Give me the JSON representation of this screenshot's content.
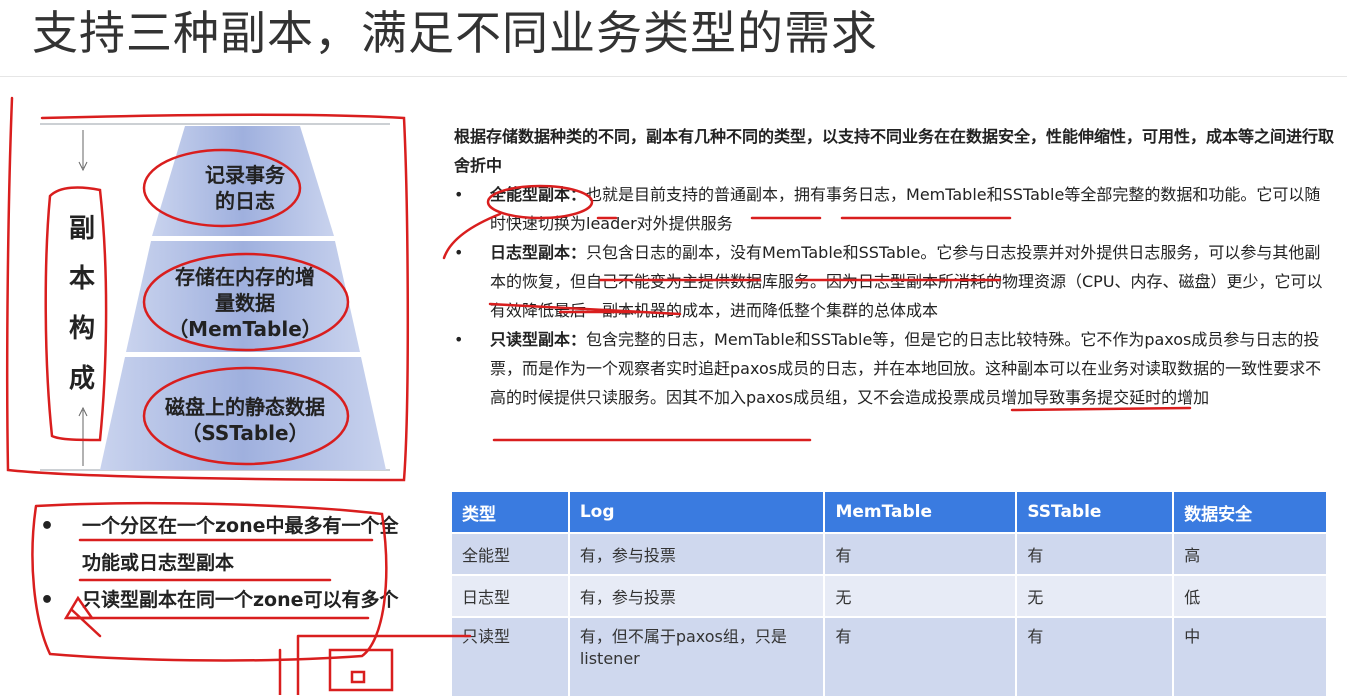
{
  "title": "支持三种副本，满足不同业务类型的需求",
  "pyramid": {
    "side_label_chars": [
      "副",
      "本",
      "构",
      "成"
    ],
    "levels": [
      {
        "label_lines": [
          "记录事务",
          "的日志"
        ]
      },
      {
        "label_lines": [
          "存储在内存的增",
          "量数据",
          "（MemTable）"
        ]
      },
      {
        "label_lines": [
          "磁盘上的静态数据",
          "（SSTable）"
        ]
      }
    ]
  },
  "left_bullets": [
    {
      "dot": "•",
      "text": "一个分区在一个zone中最多有一个全功能或日志型副本"
    },
    {
      "dot": "•",
      "text": "只读型副本在同一个zone可以有多个"
    }
  ],
  "intro": "根据存储数据种类的不同，副本有几种不同的类型，以支持不同业务在在数据安全，性能伸缩性，可用性，成本等之间进行取舍折中",
  "bullets": [
    {
      "dot": "•",
      "title": "全能型副本：",
      "text": "也就是目前支持的普通副本，拥有事务日志，MemTable和SSTable等全部完整的数据和功能。它可以随时快速切换为leader对外提供服务"
    },
    {
      "dot": "•",
      "title": "日志型副本：",
      "text": "只包含日志的副本，没有MemTable和SSTable。它参与日志投票并对外提供日志服务，可以参与其他副本的恢复，但自己不能变为主提供数据库服务。因为日志型副本所消耗的物理资源（CPU、内存、磁盘）更少，它可以有效降低最后一副本机器的成本，进而降低整个集群的总体成本"
    },
    {
      "dot": "•",
      "title": "只读型副本：",
      "text": "包含完整的日志，MemTable和SSTable等，但是它的日志比较特殊。它不作为paxos成员参与日志的投票，而是作为一个观察者实时追赶paxos成员的日志，并在本地回放。这种副本可以在业务对读取数据的一致性要求不高的时候提供只读服务。因其不加入paxos成员组，又不会造成投票成员增加导致事务提交延时的增加"
    }
  ],
  "table": {
    "headers": [
      "类型",
      "Log",
      "MemTable",
      "SSTable",
      "数据安全"
    ],
    "rows": [
      [
        "全能型",
        "有，参与投票",
        "有",
        "有",
        "高"
      ],
      [
        "日志型",
        "有，参与投票",
        "无",
        "无",
        "低"
      ],
      [
        "只读型",
        "有，但不属于paxos组，只是listener",
        "有",
        "有",
        "中"
      ]
    ]
  },
  "colors": {
    "pyramid_fill": "#a9b8e0",
    "table_header": "#3a7be0",
    "annotation_red": "#d91e1e"
  }
}
